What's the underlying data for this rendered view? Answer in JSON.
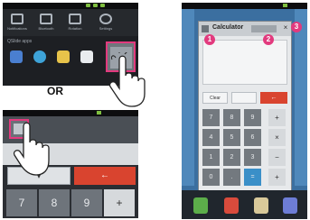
{
  "separator": {
    "label": "OR"
  },
  "panel1": {
    "quick_settings": [
      "Notifications",
      "Bluetooth",
      "Rotation",
      "Settings"
    ],
    "section_label": "QSlide apps"
  },
  "panel2": {
    "display_arrow": "▾",
    "delete_glyph": "←",
    "keys": [
      "7",
      "8",
      "9",
      "+"
    ]
  },
  "panel3": {
    "window_title": "Calculator",
    "buttons": {
      "clear": "Clear",
      "delete_glyph": "←"
    },
    "callouts": [
      "1",
      "2",
      "3"
    ],
    "keypad": [
      [
        "7",
        "8",
        "9",
        "+"
      ],
      [
        "4",
        "5",
        "6",
        "×"
      ],
      [
        "1",
        "2",
        "3",
        "−"
      ],
      [
        "0",
        ".",
        "=",
        "+"
      ]
    ]
  },
  "colors": {
    "highlight": "#e23a7e",
    "delete_button": "#d9442f",
    "wallpaper": "#3b6fa0"
  }
}
